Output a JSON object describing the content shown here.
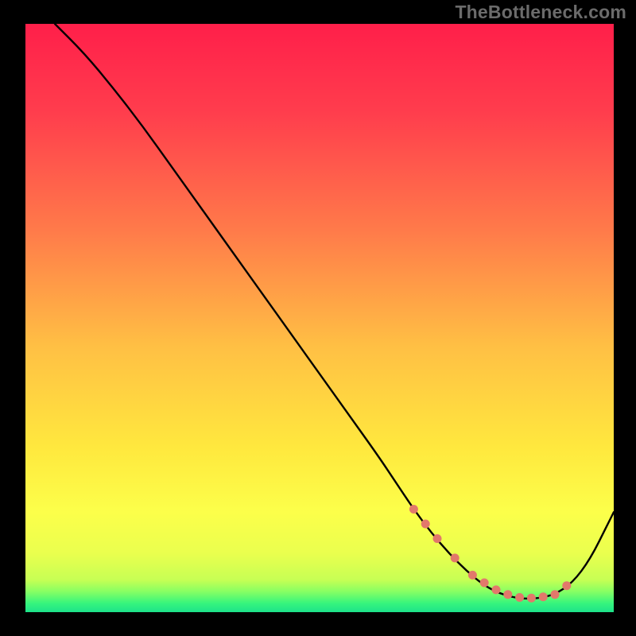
{
  "watermark": "TheBottleneck.com",
  "colors": {
    "frame": "#000000",
    "curve": "#000000",
    "marker": "#e2786b",
    "gradient_stops": [
      {
        "offset": 0.0,
        "color": "#ff1f4a"
      },
      {
        "offset": 0.15,
        "color": "#ff3d4d"
      },
      {
        "offset": 0.35,
        "color": "#ff7a4a"
      },
      {
        "offset": 0.55,
        "color": "#ffc044"
      },
      {
        "offset": 0.72,
        "color": "#ffe83e"
      },
      {
        "offset": 0.83,
        "color": "#fcff4a"
      },
      {
        "offset": 0.9,
        "color": "#eaff4e"
      },
      {
        "offset": 0.945,
        "color": "#c7ff54"
      },
      {
        "offset": 0.965,
        "color": "#87ff63"
      },
      {
        "offset": 0.985,
        "color": "#36f57d"
      },
      {
        "offset": 1.0,
        "color": "#1de28a"
      }
    ]
  },
  "chart_data": {
    "type": "line",
    "title": "",
    "xlabel": "",
    "ylabel": "",
    "xlim": [
      0,
      100
    ],
    "ylim": [
      0,
      100
    ],
    "grid": false,
    "legend": false,
    "annotations": [],
    "series": [
      {
        "name": "bottleneck-curve",
        "x": [
          5,
          10,
          15,
          20,
          25,
          30,
          35,
          40,
          45,
          50,
          55,
          60,
          63,
          66,
          69,
          72,
          75,
          78,
          81,
          84,
          87,
          90,
          93,
          96,
          99,
          100
        ],
        "y": [
          100,
          95,
          89,
          82.5,
          75.5,
          68.5,
          61.5,
          54.5,
          47.5,
          40.5,
          33.5,
          26.5,
          22,
          17.5,
          13.5,
          10,
          7,
          4.5,
          3,
          2.3,
          2.3,
          3,
          5,
          9,
          15,
          17
        ],
        "note": "y is percent of plot-area height from bottom; estimated from gridless figure"
      }
    ],
    "markers": {
      "name": "highlight-dots",
      "x": [
        66,
        68,
        70,
        73,
        76,
        78,
        80,
        82,
        84,
        86,
        88,
        90,
        92
      ],
      "y": [
        17.5,
        15,
        12.5,
        9.2,
        6.3,
        5.0,
        3.8,
        3.0,
        2.5,
        2.4,
        2.6,
        3.0,
        4.5
      ]
    }
  }
}
